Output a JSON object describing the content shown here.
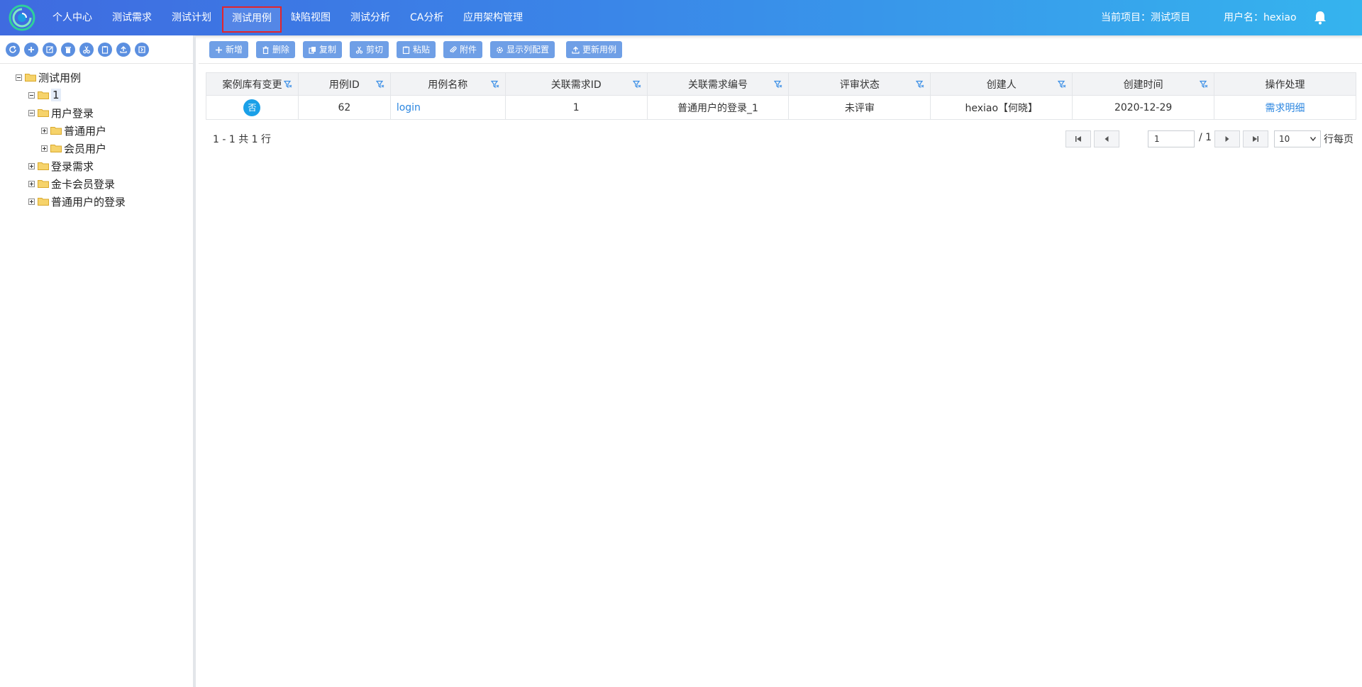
{
  "nav": {
    "items": [
      "个人中心",
      "测试需求",
      "测试计划",
      "测试用例",
      "缺陷视图",
      "测试分析",
      "CA分析",
      "应用架构管理"
    ],
    "active_index": 3,
    "current_project": "当前项目：测试项目",
    "username": "用户名：hexiao"
  },
  "sidebar": {
    "toolbar_icons": [
      "refresh-icon",
      "add-icon",
      "edit-icon",
      "delete-icon",
      "cut-icon",
      "paste-icon",
      "upload-icon",
      "export-icon"
    ],
    "tree": {
      "root": "测试用例",
      "node_1": "1",
      "user_login": "用户登录",
      "normal_user": "普通用户",
      "member_user": "会员用户",
      "login_req": "登录需求",
      "gold_member_login": "金卡会员登录",
      "normal_user_login": "普通用户的登录"
    }
  },
  "toolbar": {
    "add": "新增",
    "delete": "删除",
    "copy": "复制",
    "cut": "剪切",
    "paste": "粘贴",
    "attach": "附件",
    "columns": "显示列配置",
    "update": "更新用例"
  },
  "table": {
    "headers": [
      "案例库有变更",
      "用例ID",
      "用例名称",
      "关联需求ID",
      "关联需求编号",
      "评审状态",
      "创建人",
      "创建时间",
      "操作处理"
    ],
    "rows": [
      {
        "changed": "否",
        "case_id": "62",
        "case_name": "login",
        "req_id": "1",
        "req_no": "普通用户的登录_1",
        "review": "未评审",
        "creator": "hexiao【何晓】",
        "created": "2020-12-29",
        "action": "需求明细"
      }
    ]
  },
  "pager": {
    "summary": "1 - 1 共 1 行",
    "page": "1",
    "total": "/ 1",
    "page_size": "10",
    "suffix": "行每页"
  },
  "colors": {
    "nav_start": "#3f6be0",
    "nav_end": "#35b4ee",
    "button": "#6f9fe6",
    "badge": "#1aa0e8",
    "link": "#2b86e0",
    "active_border": "#e3242b"
  }
}
